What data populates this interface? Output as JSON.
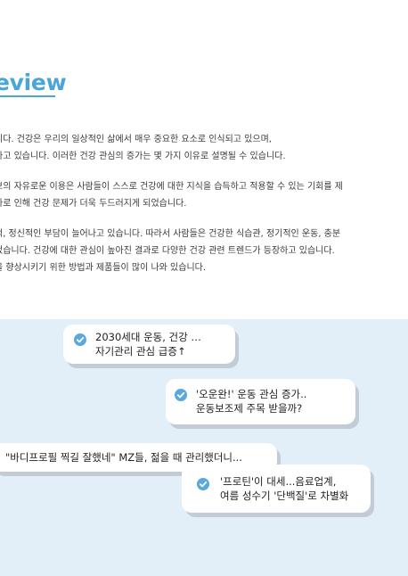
{
  "heading": "eview",
  "paragraphs": [
    {
      "lines": [
        "니다. 건강은 우리의 일상적인 삶에서 매우 중요한 요소로 인식되고 있으며,",
        "하고 있습니다. 이러한 건강 관심의 증가는 몇 가지 이유로 설명될 수 있습니다."
      ]
    },
    {
      "lines": [
        "보의 자유로운 이용은 사람들이 스스로 건강에 대한 지식을 습득하고 적용할 수 있는 기회를 제",
        "하로 인해 건강 문제가 더욱 두드러지게 되었습니다."
      ]
    },
    {
      "lines": [
        "적, 정신적인 부담이 늘어나고 있습니다. 따라서 사람들은 건강한 식습관, 정기적인 운동, 충분",
        "었습니다. 건강에 대한 관심이 높아진 결과로 다양한 건강 관련 트렌드가 등장하고 있습니다.",
        "을 향상시키기 위한 방법과 제품들이 많이 나와 있습니다."
      ]
    }
  ],
  "headlines": [
    {
      "lines": [
        "2030세대 운동, 건강 …",
        "자기관리 관심 급증↑"
      ],
      "icon": "check-circle-icon"
    },
    {
      "lines": [
        "'오운완!' 운동 관심 증가..",
        "운동보조제 주목 받을까?"
      ],
      "icon": "check-circle-icon"
    },
    {
      "lines": [
        "\"바디프로필 찍길 잘했네\" MZ들, 젊을 때 관리했더니..."
      ]
    },
    {
      "lines": [
        "'프로틴'이 대세...음료업계,",
        "여름 성수기 '단백질'로 차별화"
      ],
      "icon": "check-circle-icon"
    }
  ],
  "colors": {
    "accent": "#4aa6d8",
    "check": "#5aa9dc",
    "panel": "#e3eff8"
  }
}
